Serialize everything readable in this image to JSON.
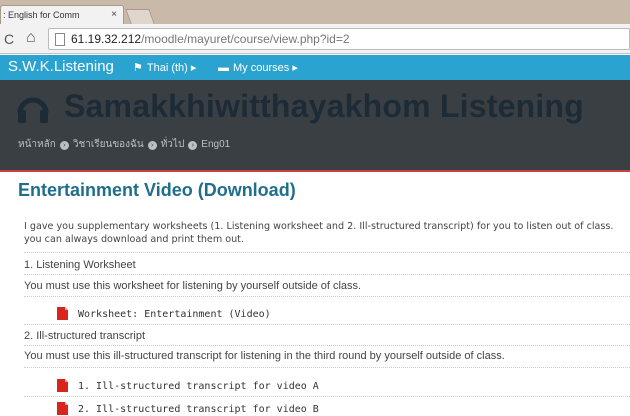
{
  "browser": {
    "tab_title": ": English for Comm",
    "tab_close": "×",
    "address_host": "61.19.32.212",
    "address_path": "/moodle/mayuret/course/view.php?id=2",
    "reload_icon": "C",
    "home_icon": "⌂"
  },
  "navbar": {
    "brand": "S.W.K.Listening",
    "language": "Thai (th)",
    "my_courses": "My courses",
    "color": "#2ba3d0"
  },
  "header": {
    "site_title": "Samakkhiwitthayakhom Listening",
    "breadcrumb": [
      "หน้าหลัก",
      "วิชาเรียนของฉัน",
      "ทั่วไป",
      "Eng01"
    ]
  },
  "content": {
    "section_title": "Entertainment Video (Download)",
    "summary_line1": "I gave you supplementary worksheets (1. Listening worksheet and 2. Ill-structured transcript) for you to listen out of class.",
    "summary_line2": "you can always download and print them out.",
    "label1_title": "1. Listening Worksheet",
    "label1_text": "You must use this worksheet for listening by yourself outside of class.",
    "resource1": "Worksheet: Entertainment (Video)",
    "label2_title": "2. Ill-structured transcript",
    "label2_text": "You must use this ill-structured transcript for listening in the third round by yourself outside of class.",
    "resource2": "1. Ill-structured transcript for video A",
    "resource3": "2. Ill-structured transcript for video B"
  }
}
